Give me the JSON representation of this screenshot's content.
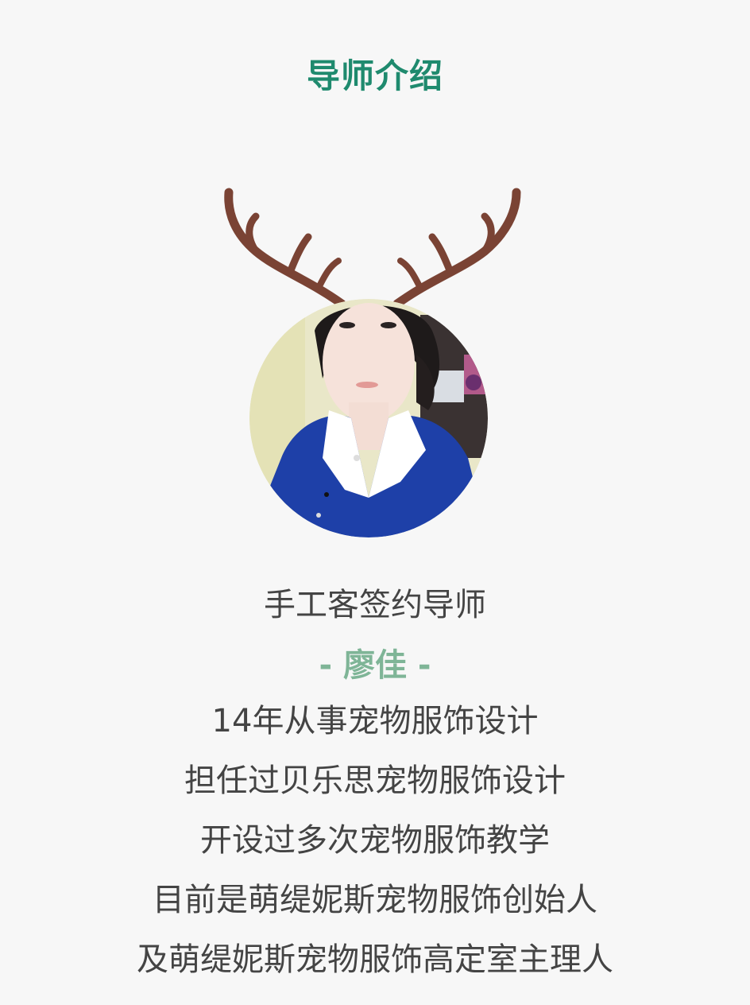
{
  "header": {
    "title": "导师介绍"
  },
  "mentor": {
    "role": "手工客签约导师",
    "name": "- 廖佳 -",
    "bio": [
      "14年从事宠物服饰设计",
      "担任过贝乐思宠物服饰设计",
      "开设过多次宠物服饰教学",
      "目前是萌缇妮斯宠物服饰创始人",
      "及萌缇妮斯宠物服饰高定室主理人"
    ]
  },
  "icons": {
    "antlers": "antlers-icon",
    "avatar": "mentor-avatar"
  },
  "colors": {
    "title": "#1f8a6e",
    "name": "#7fb597",
    "text": "#444444",
    "antler": "#7a4334",
    "background": "#f7f7f7"
  }
}
